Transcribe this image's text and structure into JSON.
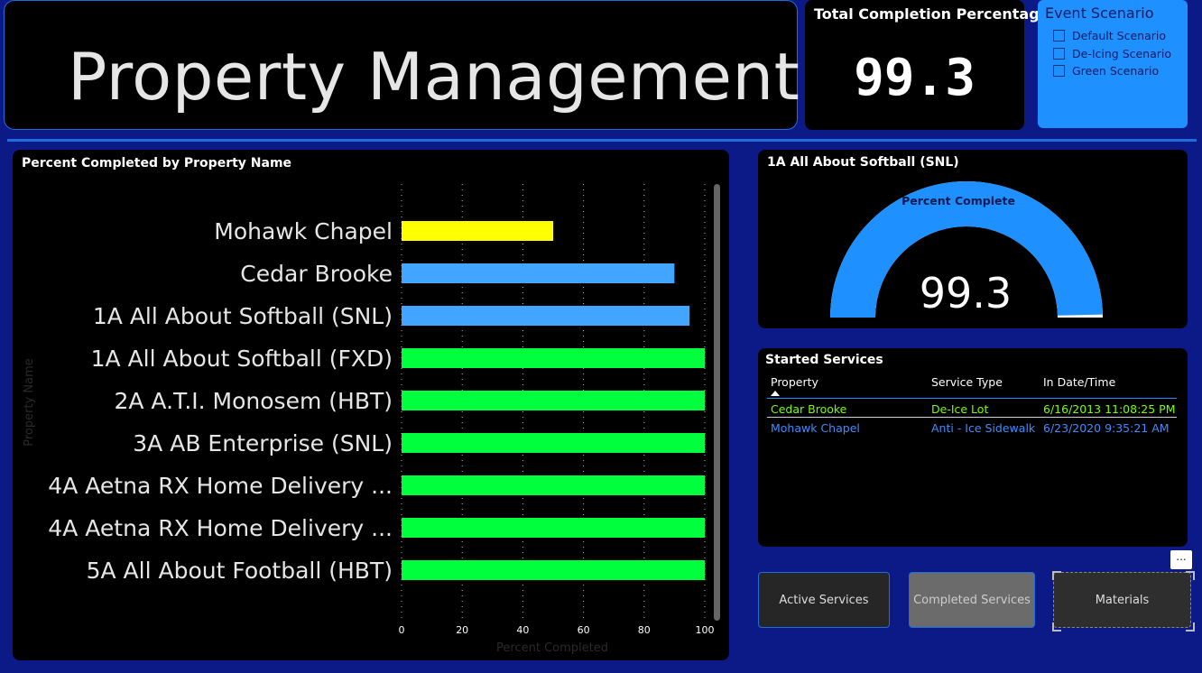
{
  "header": {
    "title": "Property Management"
  },
  "kpi": {
    "label": "Total Completion Percentage",
    "value": "99.3"
  },
  "event_scenario": {
    "title": "Event Scenario",
    "options": [
      {
        "label": "Default Scenario",
        "checked": false
      },
      {
        "label": "De-Icing Scenario",
        "checked": false
      },
      {
        "label": "Green Scenario",
        "checked": false
      }
    ]
  },
  "chart_panel": {
    "title": "Percent Completed by Property Name"
  },
  "chart_data": {
    "type": "bar",
    "orientation": "horizontal",
    "title": "Percent Completed by Property Name",
    "xlabel": "Percent Completed",
    "ylabel": "Property Name",
    "xlim": [
      0,
      100
    ],
    "xticks": [
      0,
      20,
      40,
      60,
      80,
      100
    ],
    "grid": true,
    "categories": [
      "Mohawk Chapel",
      "Cedar Brooke",
      "1A All About Softball (SNL)",
      "1A All About Softball (FXD)",
      "2A A.T.I. Monosem (HBT)",
      "3A AB Enterprise (SNL)",
      "4A Aetna RX Home Delivery ...",
      "4A Aetna RX Home Delivery ...",
      "5A All About Football (HBT)"
    ],
    "values": [
      50,
      90,
      95,
      100,
      100,
      100,
      100,
      100,
      100
    ],
    "colors": [
      "#ffff00",
      "#42a5ff",
      "#42a5ff",
      "#00ff3c",
      "#00ff3c",
      "#00ff3c",
      "#00ff3c",
      "#00ff3c",
      "#00ff3c"
    ]
  },
  "gauge": {
    "title": "1A All About Softball (SNL)",
    "label": "Percent Complete",
    "value": 99.3,
    "display_value": "99.3",
    "min": 0,
    "max": 100,
    "fill_color": "#1e90ff",
    "track_color": "#ffffff"
  },
  "started_services": {
    "title": "Started Services",
    "columns": [
      "Property",
      "Service Type",
      "In Date/Time"
    ],
    "rows": [
      {
        "property": "Cedar Brooke",
        "service_type": "De-Ice Lot",
        "datetime": "6/16/2013 11:08:25 PM",
        "color": "#7cfc00"
      },
      {
        "property": "Mohawk Chapel",
        "service_type": "Anti - Ice Sidewalk",
        "datetime": "6/23/2020 9:35:21 AM",
        "color": "#3d8dff"
      }
    ]
  },
  "nav": {
    "active_services": "Active Services",
    "completed_services": "Completed Services",
    "materials": "Materials",
    "more": "..."
  }
}
